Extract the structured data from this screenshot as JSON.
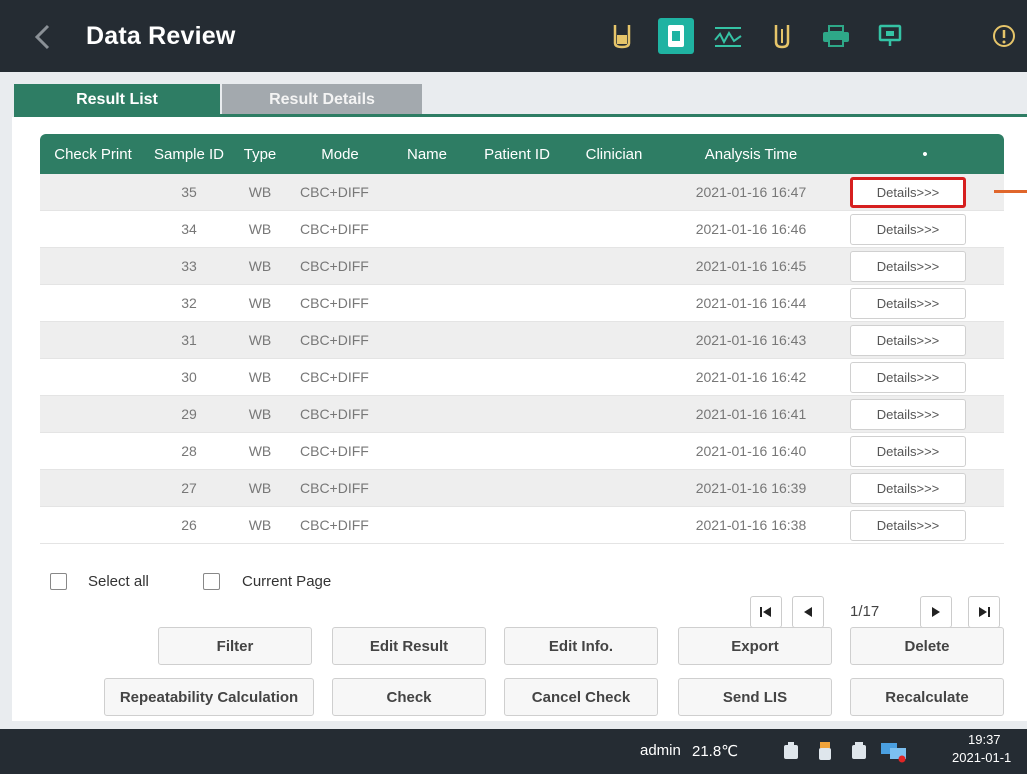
{
  "header": {
    "title": "Data Review",
    "icons": [
      "sample-tube-icon",
      "data-review-icon",
      "waveform-icon",
      "reagent-tube-icon",
      "printer-icon",
      "device-monitor-icon",
      "info-icon"
    ]
  },
  "tabs": [
    {
      "label": "Result List",
      "active": true
    },
    {
      "label": "Result Details",
      "active": false
    }
  ],
  "table": {
    "columns": [
      "Check Print",
      "Sample ID",
      "Type",
      "Mode",
      "Name",
      "Patient ID",
      "Clinician",
      "Analysis Time",
      "•"
    ],
    "details_label": "Details>>>",
    "rows": [
      {
        "sample_id": "35",
        "type": "WB",
        "mode": "CBC+DIFF",
        "time": "2021-01-16 16:47"
      },
      {
        "sample_id": "34",
        "type": "WB",
        "mode": "CBC+DIFF",
        "time": "2021-01-16 16:46"
      },
      {
        "sample_id": "33",
        "type": "WB",
        "mode": "CBC+DIFF",
        "time": "2021-01-16 16:45"
      },
      {
        "sample_id": "32",
        "type": "WB",
        "mode": "CBC+DIFF",
        "time": "2021-01-16 16:44"
      },
      {
        "sample_id": "31",
        "type": "WB",
        "mode": "CBC+DIFF",
        "time": "2021-01-16 16:43"
      },
      {
        "sample_id": "30",
        "type": "WB",
        "mode": "CBC+DIFF",
        "time": "2021-01-16 16:42"
      },
      {
        "sample_id": "29",
        "type": "WB",
        "mode": "CBC+DIFF",
        "time": "2021-01-16 16:41"
      },
      {
        "sample_id": "28",
        "type": "WB",
        "mode": "CBC+DIFF",
        "time": "2021-01-16 16:40"
      },
      {
        "sample_id": "27",
        "type": "WB",
        "mode": "CBC+DIFF",
        "time": "2021-01-16 16:39"
      },
      {
        "sample_id": "26",
        "type": "WB",
        "mode": "CBC+DIFF",
        "time": "2021-01-16 16:38"
      }
    ]
  },
  "selection": {
    "select_all": "Select all",
    "current_page": "Current Page"
  },
  "pager": {
    "page": "1/17"
  },
  "actions": {
    "filter": "Filter",
    "edit_result": "Edit Result",
    "edit_info": "Edit Info.",
    "export": "Export",
    "delete": "Delete",
    "repeatability": "Repeatability Calculation",
    "check": "Check",
    "cancel_check": "Cancel Check",
    "send_lis": "Send LIS",
    "recalculate": "Recalculate"
  },
  "status": {
    "user": "admin",
    "temperature": "21.8℃",
    "time": "19:37",
    "date": "2021-01-1"
  },
  "colors": {
    "accent": "#2e7d64",
    "active_icon": "#1fb3a2",
    "highlight": "#d61f1f",
    "callout": "#e0662b"
  }
}
